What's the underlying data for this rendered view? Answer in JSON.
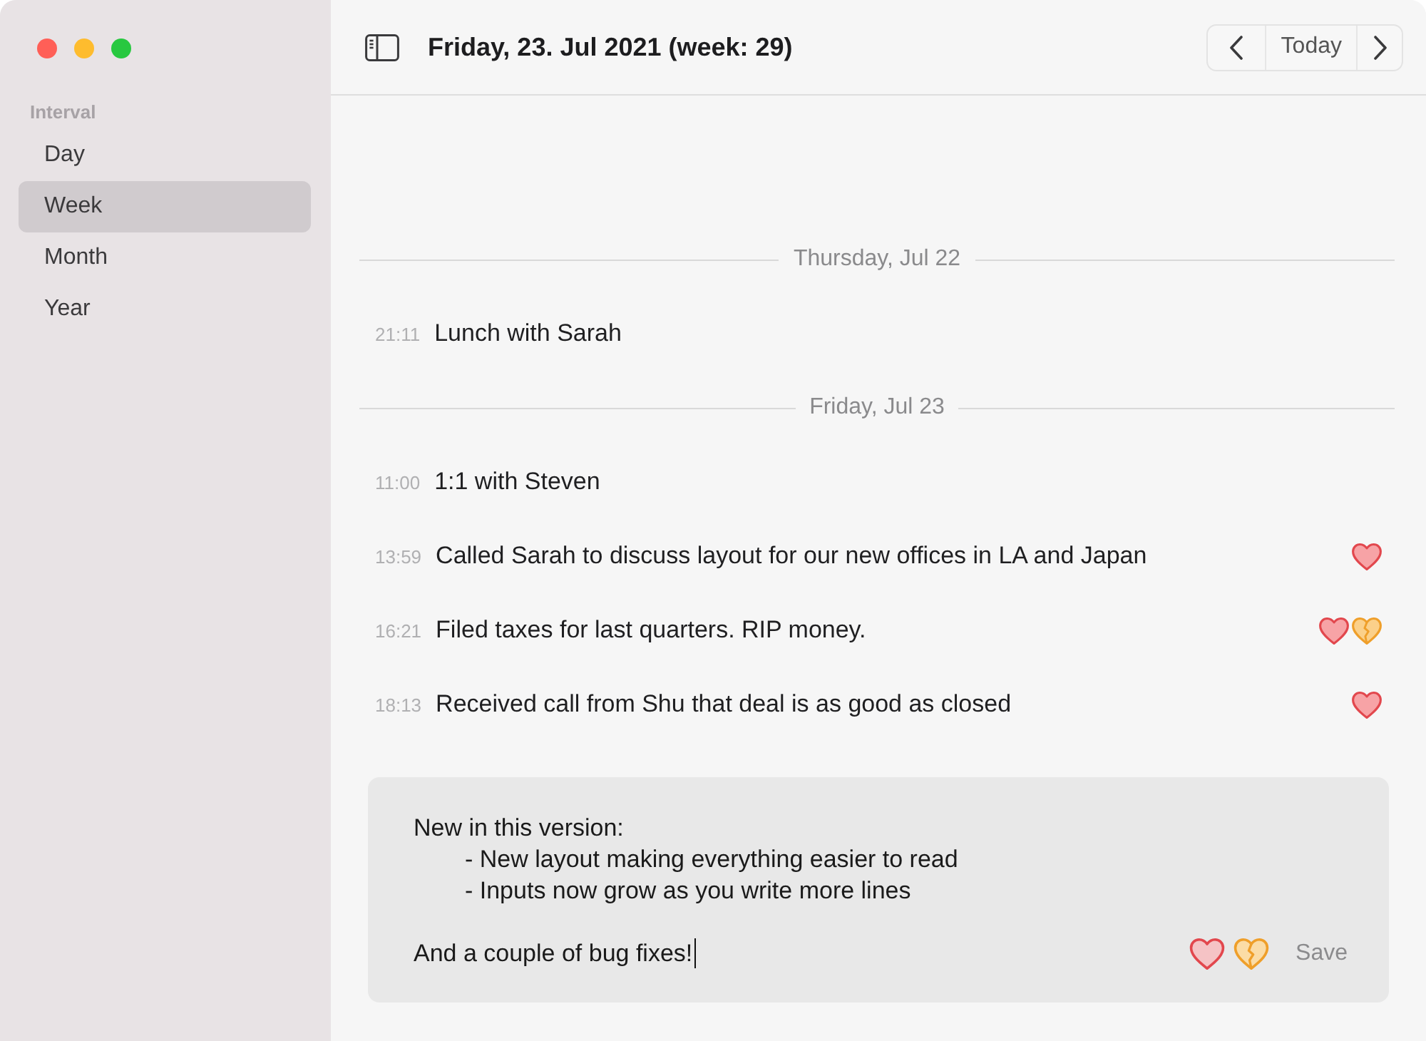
{
  "window_controls": [
    {
      "color": "#ff5f57"
    },
    {
      "color": "#febc2e"
    },
    {
      "color": "#28c840"
    }
  ],
  "sidebar": {
    "heading": "Interval",
    "items": [
      {
        "label": "Day",
        "selected": false
      },
      {
        "label": "Week",
        "selected": true
      },
      {
        "label": "Month",
        "selected": false
      },
      {
        "label": "Year",
        "selected": false
      }
    ]
  },
  "toolbar": {
    "title": "Friday, 23. Jul 2021 (week: 29)",
    "today_button": "Today"
  },
  "days": [
    {
      "heading": "Thursday, Jul 22",
      "entries": [
        {
          "time": "21:11",
          "text": "Lunch with Sarah"
        }
      ]
    },
    {
      "heading": "Friday, Jul 23",
      "entries": [
        {
          "time": "11:00",
          "text": "1:1 with Steven"
        },
        {
          "time": "13:59",
          "text": "Called Sarah to discuss layout for our new offices in LA and Japan",
          "reactions": [
            {
              "kind": "heart"
            }
          ]
        },
        {
          "time": "16:21",
          "text": "Filed taxes for last quarters. RIP money.",
          "reactions": [
            {
              "kind": "heart"
            },
            {
              "kind": "broken-heart"
            }
          ]
        },
        {
          "time": "18:13",
          "text": "Received call from Shu that deal is as good as closed",
          "reactions": [
            {
              "kind": "heart"
            }
          ]
        }
      ]
    }
  ],
  "composer": {
    "value": "New in this version:\n\t- New layout making everything easier to read\n\t- Inputs now grow as you write more lines\n\nAnd a couple of bug fixes!",
    "focused": true,
    "reactions": [
      {
        "kind": "heart"
      },
      {
        "kind": "broken-heart"
      }
    ],
    "save_button": "Save"
  }
}
